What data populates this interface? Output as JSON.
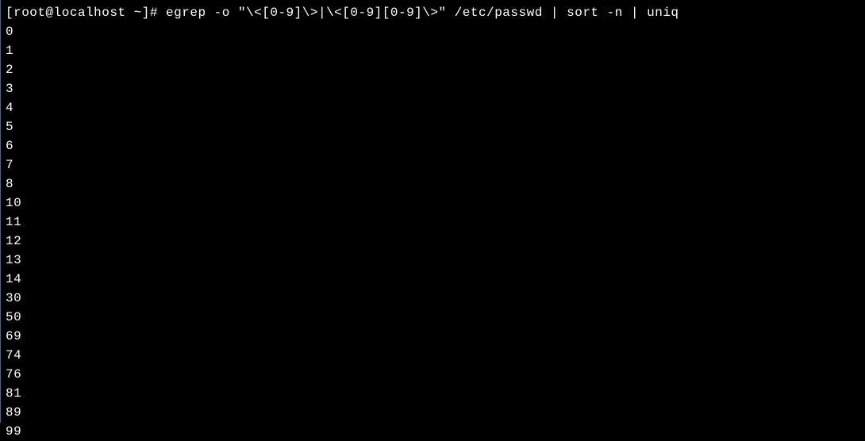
{
  "terminal": {
    "prompt": "[root@localhost ~]# ",
    "command": "egrep -o \"\\<[0-9]\\>|\\<[0-9][0-9]\\>\" /etc/passwd | sort -n | uniq",
    "output": [
      "0",
      "1",
      "2",
      "3",
      "4",
      "5",
      "6",
      "7",
      "8",
      "10",
      "11",
      "12",
      "13",
      "14",
      "30",
      "50",
      "69",
      "74",
      "76",
      "81",
      "89",
      "99"
    ]
  }
}
